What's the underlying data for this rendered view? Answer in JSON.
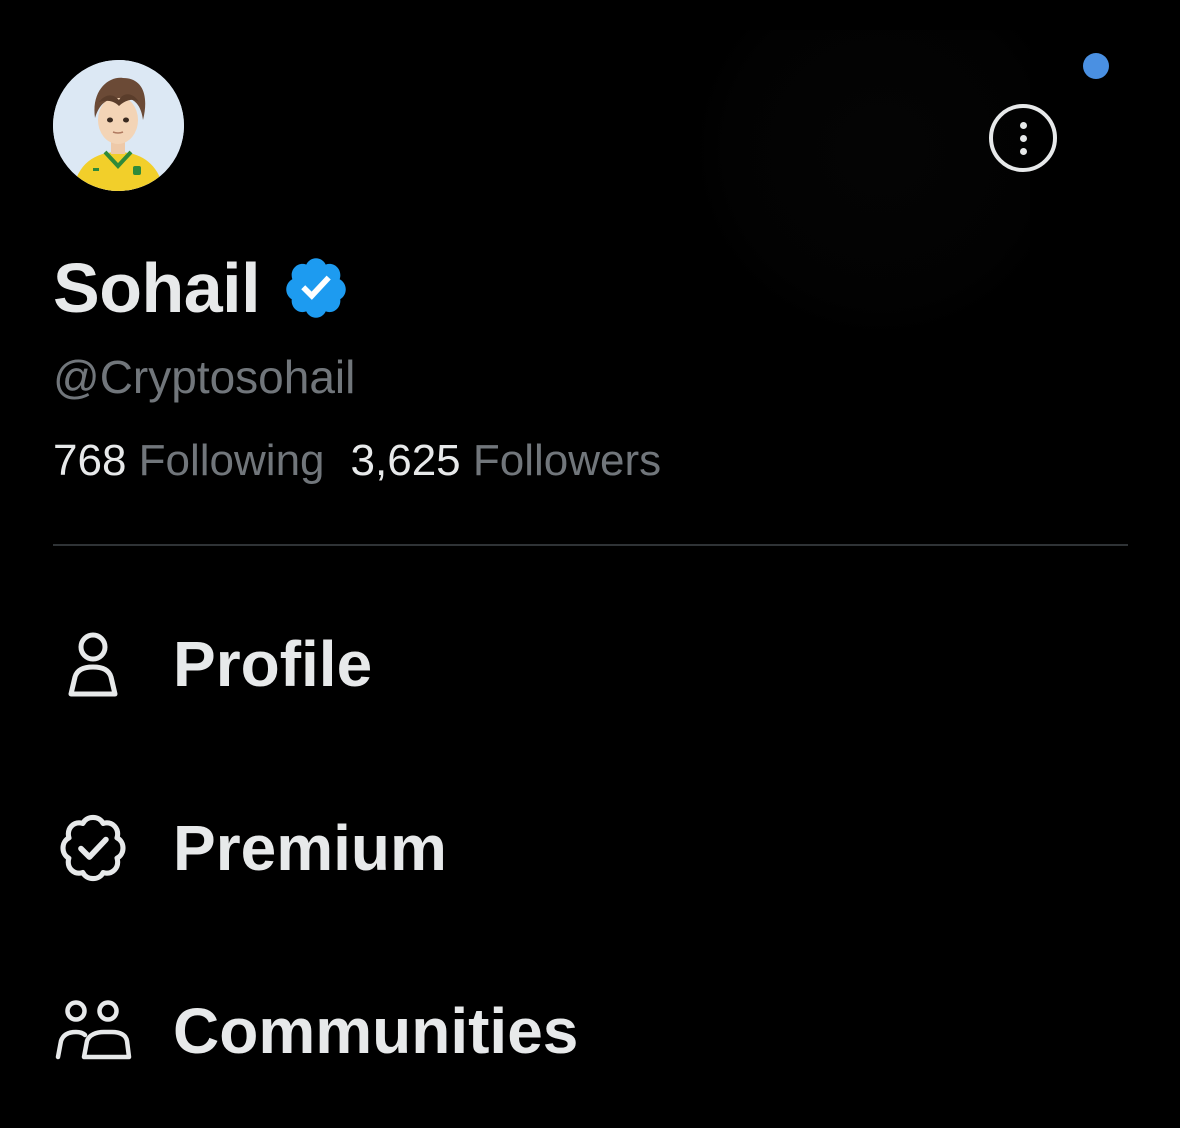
{
  "colors": {
    "background": "#000000",
    "text_primary": "#e7e9ea",
    "text_secondary": "#71767b",
    "accent_blue": "#1d9bf0",
    "notification_dot": "#4a90e2",
    "divider": "#2f3336"
  },
  "profile": {
    "display_name": "Sohail",
    "handle": "@Cryptosohail",
    "verified": true,
    "avatar_icon": "avatar-anime-boy-yellow-jersey"
  },
  "stats": {
    "following_count": "768",
    "following_label": "Following",
    "followers_count": "3,625",
    "followers_label": "Followers"
  },
  "menu": {
    "items": [
      {
        "label": "Profile",
        "icon": "person-icon"
      },
      {
        "label": "Premium",
        "icon": "verified-badge-outline-icon"
      },
      {
        "label": "Communities",
        "icon": "communities-icon"
      }
    ]
  },
  "header": {
    "more_icon": "more-options-icon",
    "has_notification": true
  }
}
